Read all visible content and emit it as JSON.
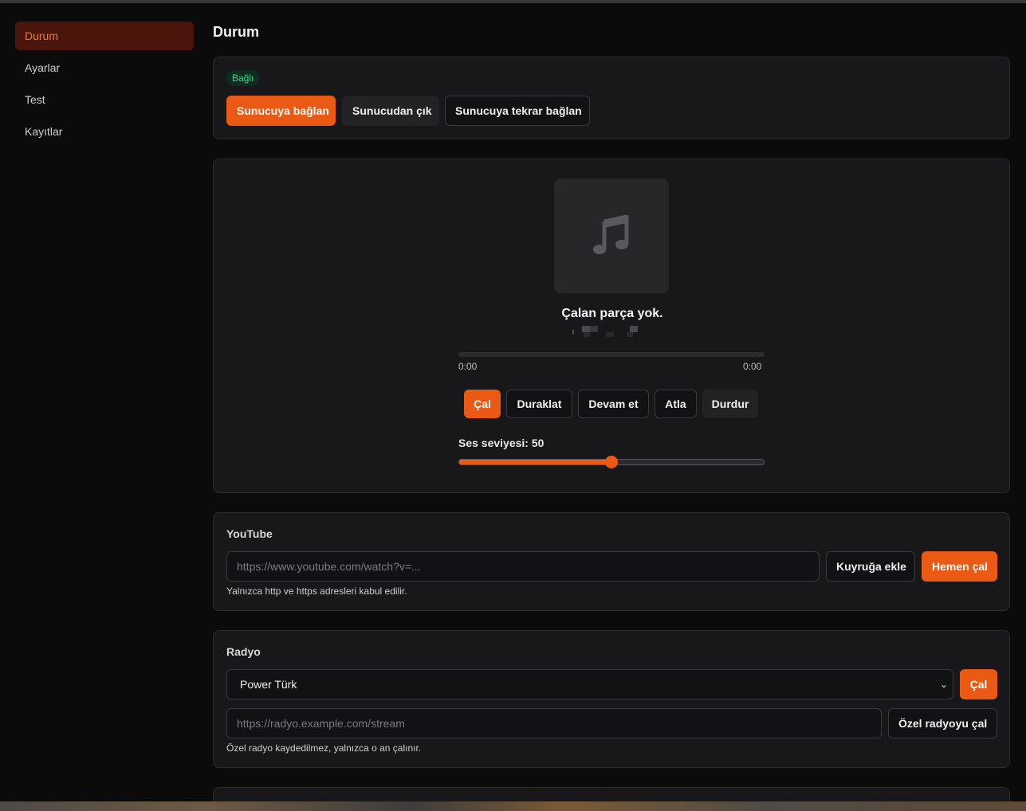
{
  "sidebar": {
    "items": [
      {
        "label": "Durum",
        "active": true
      },
      {
        "label": "Ayarlar",
        "active": false
      },
      {
        "label": "Test",
        "active": false
      },
      {
        "label": "Kayıtlar",
        "active": false
      }
    ]
  },
  "page": {
    "title": "Durum"
  },
  "connection": {
    "status_badge": "Bağlı",
    "connect_label": "Sunucuya bağlan",
    "disconnect_label": "Sunucudan çık",
    "reconnect_label": "Sunucuya tekrar bağlan"
  },
  "player": {
    "art_icon": "music-note-icon",
    "track_title": "Çalan parça yok.",
    "progress": 0,
    "time_current": "0:00",
    "time_total": "0:00",
    "buttons": {
      "play": "Çal",
      "pause": "Duraklat",
      "resume": "Devam et",
      "skip": "Atla",
      "stop": "Durdur"
    },
    "volume_label": "Ses seviyesi: 50",
    "volume": 50,
    "volume_max": 100
  },
  "youtube": {
    "title": "YouTube",
    "url_placeholder": "https://www.youtube.com/watch?v=...",
    "url_value": "",
    "queue_label": "Kuyruğa ekle",
    "play_now_label": "Hemen çal",
    "hint": "Yalnızca http ve https adresleri kabul edilir."
  },
  "radio": {
    "title": "Radyo",
    "selected_station": "Power Türk",
    "play_label": "Çal",
    "custom_placeholder": "https://radyo.example.com/stream",
    "custom_value": "",
    "custom_play_label": "Özel radyoyu çal",
    "hint": "Özel radyo kaydedilmez, yalnızca o an çalınır."
  },
  "colors": {
    "accent": "#ea5a14",
    "success": "#3ddc84",
    "background": "#0b0b0c",
    "card": "#18181a"
  }
}
